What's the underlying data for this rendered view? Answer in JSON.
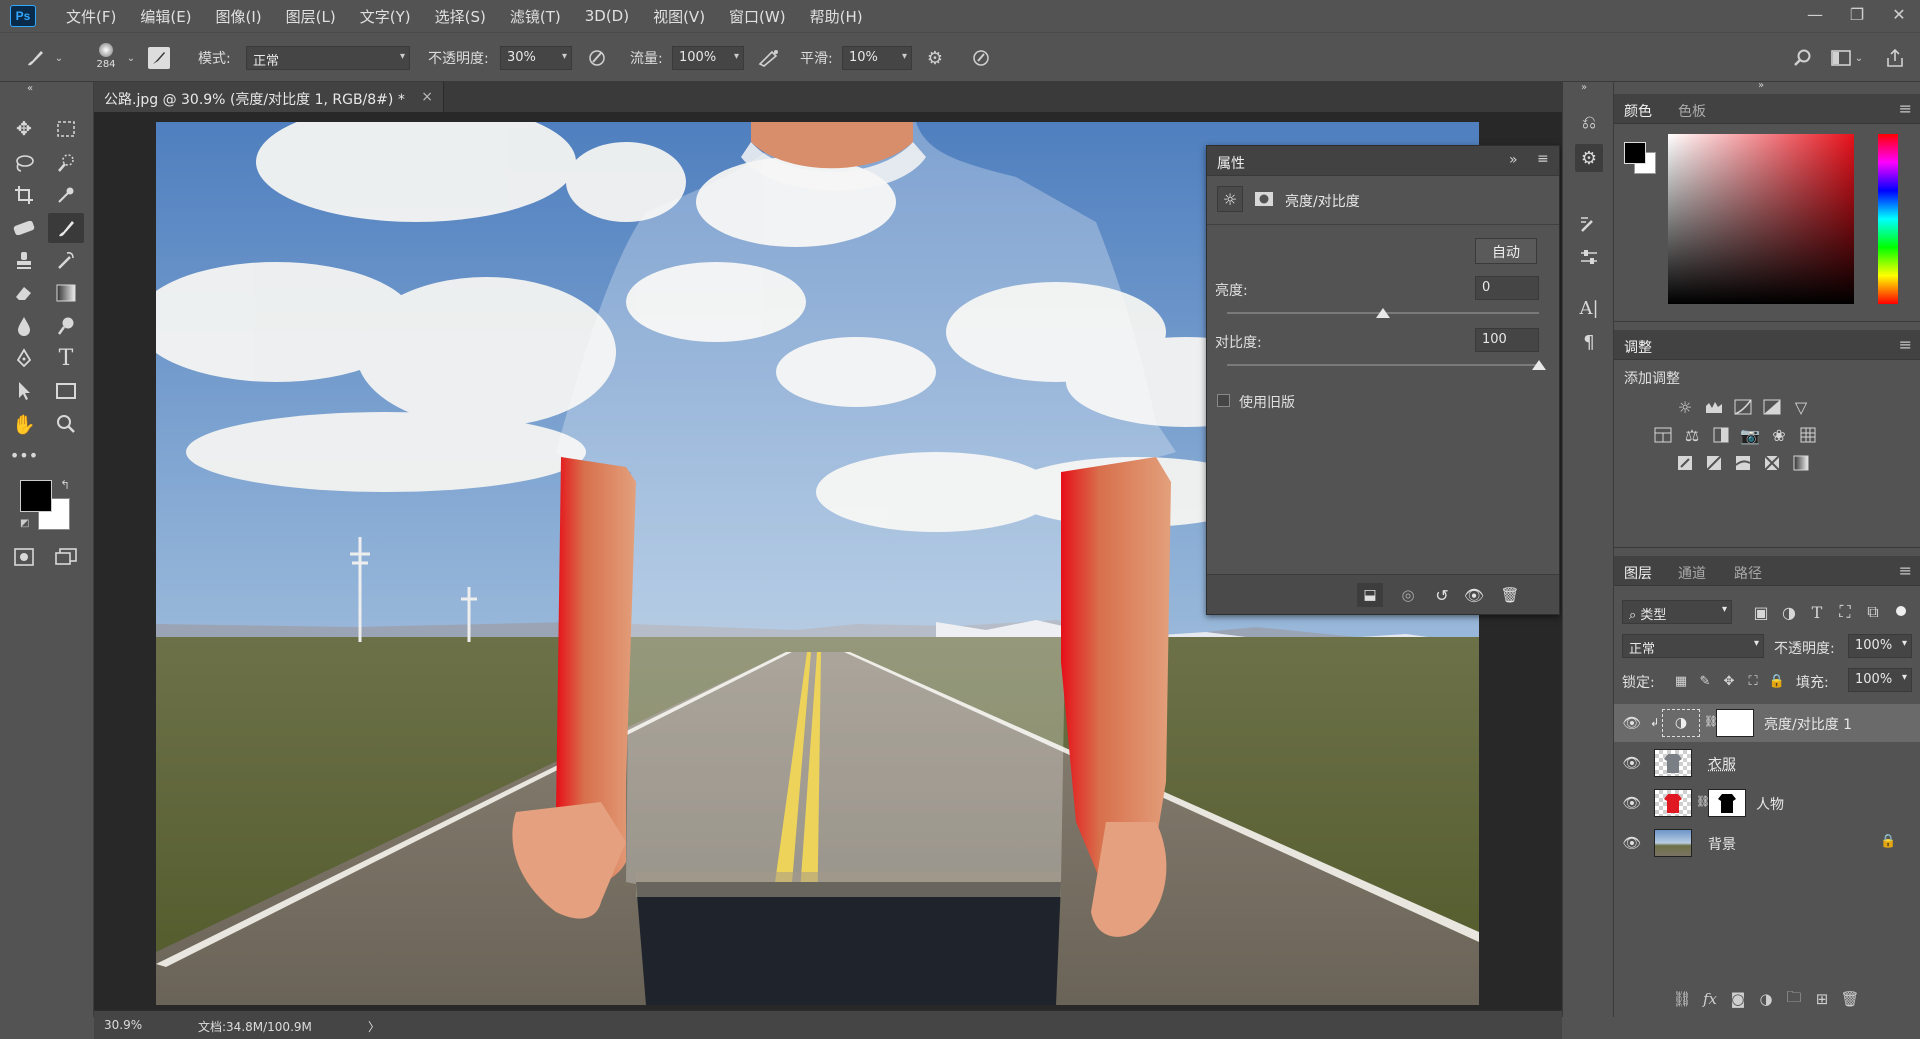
{
  "app": {
    "logo": "Ps"
  },
  "menu": [
    "文件(F)",
    "编辑(E)",
    "图像(I)",
    "图层(L)",
    "文字(Y)",
    "选择(S)",
    "滤镜(T)",
    "3D(D)",
    "视图(V)",
    "窗口(W)",
    "帮助(H)"
  ],
  "window_controls": [
    "—",
    "❐",
    "✕"
  ],
  "options": {
    "brush_size": "284",
    "mode_label": "模式:",
    "mode_value": "正常",
    "opacity_label": "不透明度:",
    "opacity_value": "30%",
    "flow_label": "流量:",
    "flow_value": "100%",
    "smooth_label": "平滑:",
    "smooth_value": "10%"
  },
  "document": {
    "tab_title": "公路.jpg @ 30.9% (亮度/对比度 1, RGB/8#) *",
    "close": "×",
    "zoom": "30.9%",
    "doc_info": "文档:34.8M/100.9M",
    "arrow": "〉"
  },
  "properties": {
    "title": "属性",
    "expand": "»",
    "adjust_name": "亮度/对比度",
    "auto": "自动",
    "brightness_label": "亮度:",
    "brightness_value": "0",
    "brightness": {
      "min": -150,
      "max": 150,
      "value": 0
    },
    "contrast_label": "对比度:",
    "contrast_value": "100",
    "contrast": {
      "min": -50,
      "max": 100,
      "value": 100
    },
    "legacy_label": "使用旧版"
  },
  "color_panel": {
    "tabs": [
      "颜色",
      "色板"
    ],
    "foreground": "#000000",
    "background": "#ffffff"
  },
  "adjust_panel": {
    "tab": "调整",
    "add_label": "添加调整"
  },
  "layers_panel": {
    "tabs": [
      "图层",
      "通道",
      "路径"
    ],
    "filter_kind": "类型",
    "blend_mode": "正常",
    "opacity_label": "不透明度:",
    "opacity_value": "100%",
    "lock_label": "锁定:",
    "fill_label": "填充:",
    "fill_value": "100%",
    "layers": [
      {
        "name": "亮度/对比度 1",
        "selected": true
      },
      {
        "name": "衣服",
        "selected": false
      },
      {
        "name": "人物",
        "selected": false
      },
      {
        "name": "背景",
        "selected": false
      }
    ]
  }
}
